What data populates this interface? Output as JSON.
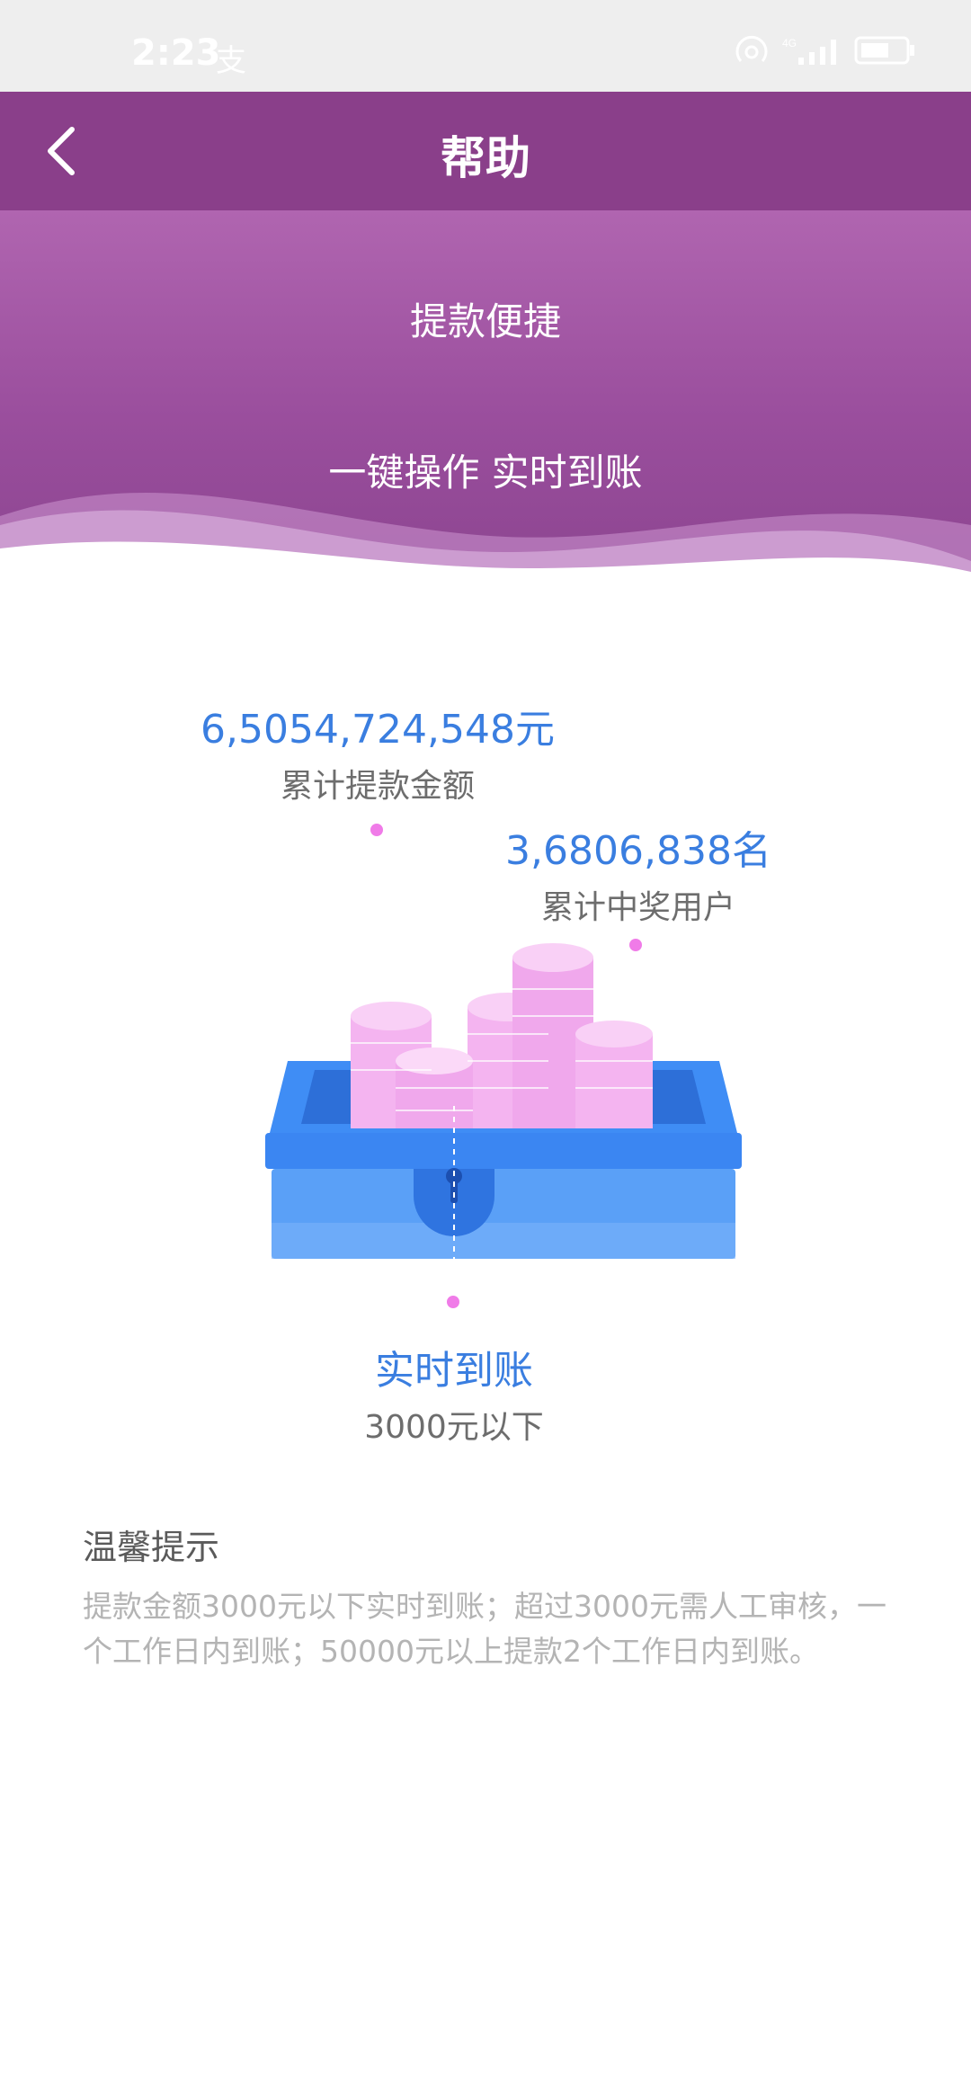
{
  "status_bar": {
    "time": "2:23",
    "alipay_glyph": "支"
  },
  "header": {
    "title": "帮助",
    "back_icon": "chevron-left-icon"
  },
  "banner": {
    "line1": "提款便捷",
    "line2": "一键操作 实时到账"
  },
  "stats": {
    "withdraw_total": {
      "value": "6,5054,724,548元",
      "label": "累计提款金额"
    },
    "winning_users": {
      "value": "3,6806,838名",
      "label": "累计中奖用户"
    },
    "realtime": {
      "value": "实时到账",
      "label": "3000元以下"
    }
  },
  "tips": {
    "title": "温馨提示",
    "body": "提款金额3000元以下实时到账；超过3000元需人工审核，一个工作日内到账；50000元以上提款2个工作日内到账。"
  },
  "colors": {
    "header_bg": "#8a3f8a",
    "accent_blue": "#3a7ee0",
    "coin_pink": "#f4b4f0",
    "box_blue": "#3f8df5"
  }
}
